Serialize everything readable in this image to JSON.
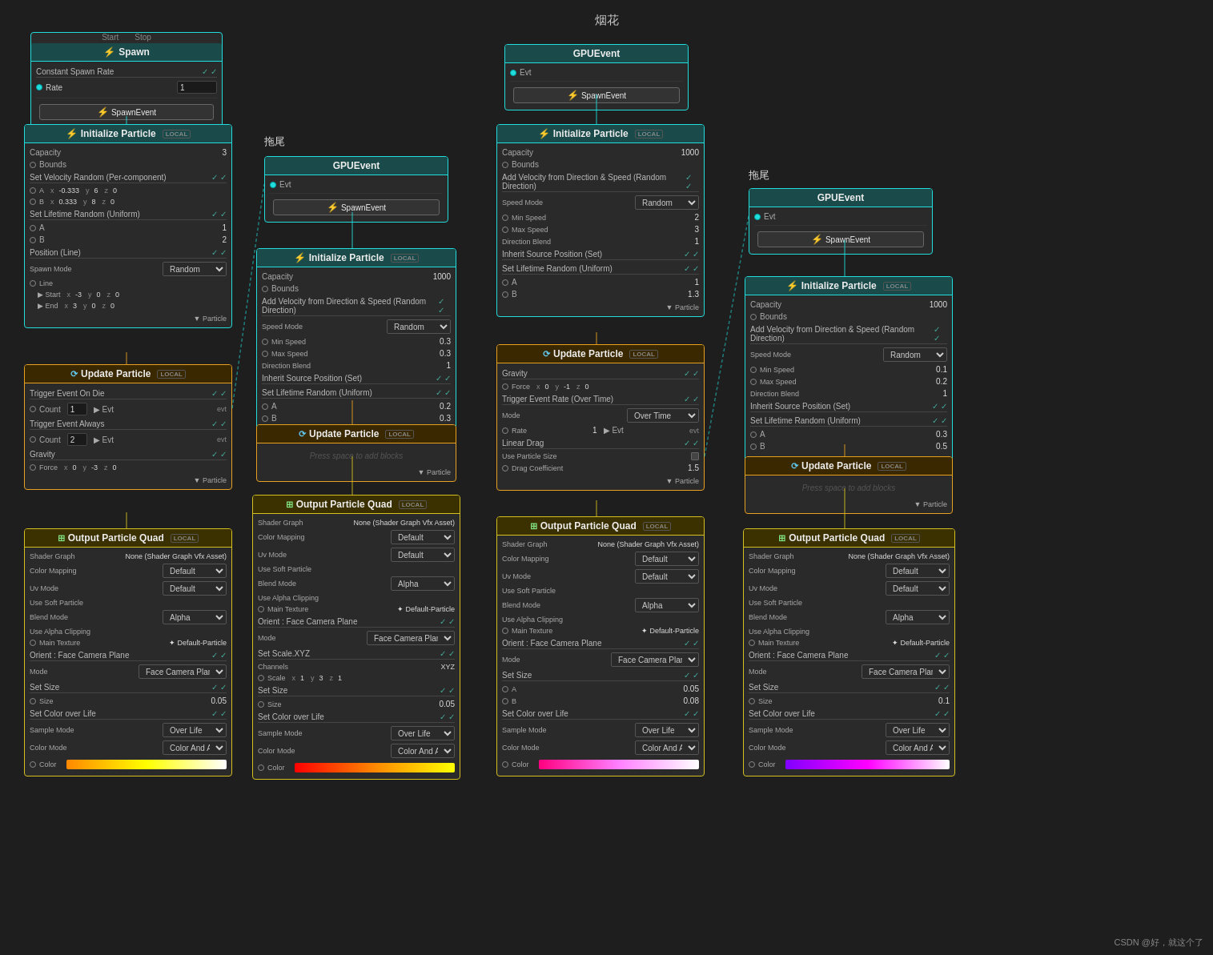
{
  "title": "烟花",
  "group1_title": "拖尾",
  "group2_title": "拖尾",
  "watermark": "CSDN @好，就这个了",
  "placeholder": "Press space to add blocks",
  "spawn_node": {
    "title": "Spawn",
    "section": "Constant Spawn Rate",
    "rate_label": "Rate",
    "rate_value": "1",
    "spawn_event": "SpawnEvent"
  },
  "init_particle_1": {
    "title": "Initialize Particle",
    "badge": "LOCAL",
    "capacity_label": "Capacity",
    "capacity_value": "3",
    "bounds_label": "Bounds",
    "velocity_section": "Set Velocity Random (Per-component)",
    "a_label": "A",
    "b_label": "B",
    "a_x": "-0.333",
    "a_y": "6",
    "a_z": "0",
    "b_x": "0.333",
    "b_y": "8",
    "b_z": "0",
    "lifetime_section": "Set Lifetime Random (Uniform)",
    "lt_a": "1",
    "lt_b": "2",
    "position_section": "Position (Line)",
    "spawn_mode": "Random",
    "line_label": "Line",
    "start_x": "-3",
    "start_y": "0",
    "start_z": "0",
    "end_x": "3",
    "end_y": "0",
    "end_z": "0"
  },
  "update_particle_1": {
    "title": "Update Particle",
    "badge": "LOCAL",
    "trigger_die": "Trigger Event On Die",
    "count_die": "1",
    "evt_die": "Evt",
    "trigger_always": "Trigger Event Always",
    "count_always": "2",
    "evt_always": "Evt",
    "gravity": "Gravity",
    "force_x": "0",
    "force_y": "-3",
    "force_z": "0"
  },
  "output_quad_1": {
    "title": "Output Particle Quad",
    "badge": "LOCAL",
    "shader_graph": "None (Shader Graph Vfx Asset)",
    "color_mapping": "Default",
    "uv_mode": "Default",
    "blend_mode": "Alpha",
    "main_texture": "Default-Particle",
    "orient_section": "Orient : Face Camera Plane",
    "mode": "Face Camera Plane",
    "size_section": "Set Size",
    "size_value": "0.05",
    "color_section": "Set Color over Life",
    "sample_mode": "Over Life",
    "color_mode": "Color And Alpha",
    "gradient_type": "yellow"
  },
  "gpu_event_1": {
    "title": "GPUEvent",
    "evt_label": "Evt",
    "spawn_event": "SpawnEvent"
  },
  "init_particle_2": {
    "title": "Initialize Particle",
    "badge": "LOCAL",
    "capacity_value": "1000",
    "velocity_section": "Add Velocity from Direction & Speed (Random Direction)",
    "speed_mode": "Random",
    "min_speed": "0.3",
    "max_speed": "0.3",
    "direction_blend": "1",
    "inherit_section": "Inherit Source Position (Set)",
    "lifetime_section": "Set Lifetime Random (Uniform)",
    "lt_a": "0.2",
    "lt_b": "0.3"
  },
  "update_particle_2": {
    "title": "Update Particle",
    "badge": "LOCAL",
    "placeholder": "Press space to add blocks"
  },
  "output_quad_2": {
    "title": "Output Particle Quad",
    "badge": "LOCAL",
    "shader_graph": "None (Shader Graph Vfx Asset)",
    "color_mapping": "Default",
    "uv_mode": "Default",
    "blend_mode": "Alpha",
    "main_texture": "Default-Particle",
    "orient_section": "Orient : Face Camera Plane",
    "mode": "Face Camera Plane",
    "scale_section": "Set Scale.XYZ",
    "channels": "XYZ",
    "scale_x": "1",
    "scale_y": "3",
    "scale_z": "1",
    "size_section": "Set Size",
    "size_value": "0.05",
    "color_section": "Set Color over Life",
    "sample_mode": "Over Life",
    "color_mode": "Color And Alpha",
    "gradient_type": "red"
  },
  "firework_title": "烟花",
  "gpu_event_2": {
    "title": "GPUEvent",
    "evt_label": "Evt",
    "spawn_event": "SpawnEvent"
  },
  "init_particle_3": {
    "title": "Initialize Particle",
    "badge": "LOCAL",
    "capacity_value": "1000",
    "velocity_section": "Add Velocity from Direction & Speed (Random Direction)",
    "speed_mode": "Random",
    "min_speed": "2",
    "max_speed": "3",
    "direction_blend": "1",
    "inherit_section": "Inherit Source Position (Set)",
    "lifetime_section": "Set Lifetime Random (Uniform)",
    "lt_a": "1",
    "lt_b": "1.3"
  },
  "update_particle_3": {
    "title": "Update Particle",
    "badge": "LOCAL",
    "gravity": "Gravity",
    "force_y": "-1",
    "trigger_rate": "Trigger Event Rate (Over Time)",
    "mode": "Over Time",
    "rate": "1",
    "drag": "Linear Drag",
    "use_particle_size": "Use Particle Size",
    "drag_coeff": "1.5"
  },
  "output_quad_3": {
    "title": "Output Particle Quad",
    "badge": "LOCAL",
    "shader_graph": "None (Shader Graph Vfx Asset)",
    "color_mapping": "Default",
    "uv_mode": "Default",
    "blend_mode": "Alpha",
    "main_texture": "Default-Particle",
    "orient_section": "Orient : Face Camera Plane",
    "mode": "Face Camera Plane",
    "size_section": "Set Size",
    "size_a": "0.05",
    "size_b": "0.08",
    "color_section": "Set Color over Life",
    "sample_mode": "Over Life",
    "color_mode": "Color And Alpha",
    "gradient_type": "magenta"
  },
  "gpu_event_3": {
    "title": "GPUEvent",
    "evt_label": "Evt",
    "spawn_event": "SpawnEvent"
  },
  "init_particle_4": {
    "title": "Initialize Particle",
    "badge": "LOCAL",
    "capacity_value": "1000",
    "velocity_section": "Add Velocity from Direction & Speed (Random Direction)",
    "speed_mode": "Random",
    "min_speed": "0.1",
    "max_speed": "0.2",
    "direction_blend": "1",
    "inherit_section": "Inherit Source Position (Set)",
    "lifetime_section": "Set Lifetime Random (Uniform)",
    "lt_a": "0.3",
    "lt_b": "0.5"
  },
  "update_particle_4": {
    "title": "Update Particle",
    "badge": "LOCAL",
    "placeholder": "Press space to add blocks"
  },
  "output_quad_4": {
    "title": "Output Particle Quad",
    "badge": "LOCAL",
    "shader_graph": "None (Shader Graph Vfx Asset)",
    "color_mapping": "Default",
    "uv_mode": "Default",
    "blend_mode": "Alpha",
    "main_texture": "Default-Particle",
    "orient_section": "Orient : Face Camera Plane",
    "mode": "Face Camera Plane",
    "size_section": "Set Size",
    "size_value": "0.1",
    "color_section": "Set Color over Life",
    "sample_mode": "Over Life",
    "color_mode": "Color And Alpha",
    "gradient_type": "purple"
  }
}
